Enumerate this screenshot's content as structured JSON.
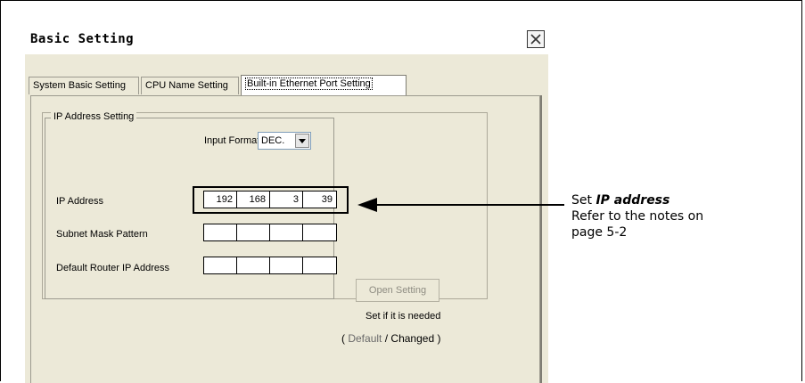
{
  "window": {
    "title": "Basic Setting"
  },
  "tabs": [
    {
      "label": "System Basic Setting",
      "active": false
    },
    {
      "label": "CPU Name Setting",
      "active": false
    },
    {
      "label": "Built-in Ethernet Port Setting",
      "active": true
    }
  ],
  "ip_group": {
    "label": "IP Address Setting",
    "input_format_label": "Input Format",
    "input_format_value": "DEC.",
    "ip_address_label": "IP Address",
    "ip_address": [
      "192",
      "168",
      "3",
      "39"
    ],
    "subnet_label": "Subnet Mask Pattern",
    "router_label": "Default Router IP Address"
  },
  "open_setting": {
    "button_label": "Open Setting",
    "note": "Set if it is needed",
    "paren_open": "(",
    "default_label": "Default",
    "separator": "/",
    "changed_label": "Changed",
    "paren_close": ")"
  },
  "callout": {
    "prefix": "Set ",
    "emphasis": "IP address",
    "line1": "Refer to the notes on",
    "line2": "page 5-2"
  },
  "colors": {
    "window_bg": "#ece9d8",
    "border": "#000000"
  }
}
